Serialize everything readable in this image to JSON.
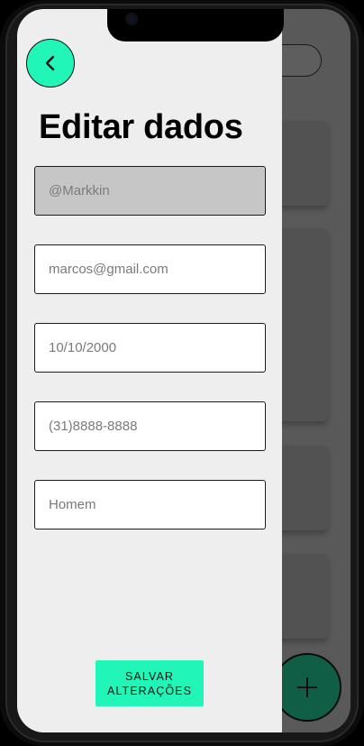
{
  "drawer": {
    "title": "Editar dados",
    "fields": [
      {
        "name": "username",
        "value": "@Markkin",
        "readonly": true
      },
      {
        "name": "email",
        "value": "marcos@gmail.com"
      },
      {
        "name": "birthdate",
        "value": "10/10/2000"
      },
      {
        "name": "phone",
        "value": "(31)8888-8888"
      },
      {
        "name": "gender",
        "value": "Homem"
      }
    ],
    "save_label_line1": "SALVAR",
    "save_label_line2": "ALTERAÇÕES"
  },
  "icons": {
    "back": "chevron-left-icon",
    "fab": "plus-icon"
  },
  "colors": {
    "accent": "#22f5b8",
    "fab": "#0f5e45",
    "drawer_bg": "#eeeeee",
    "overlay": "#595959"
  }
}
